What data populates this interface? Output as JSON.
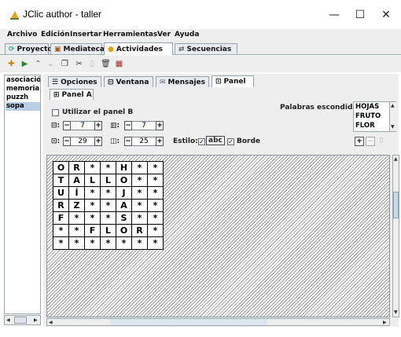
{
  "window": {
    "title": "JClic author - taller",
    "minimize": "—",
    "maximize": "☐",
    "close": "✕"
  },
  "menu": [
    "Archivo",
    "Edición",
    "Insertar",
    "Herramientas",
    "Ver",
    "Ayuda"
  ],
  "main_tabs": [
    {
      "label": "Proyecto",
      "icon": "project-icon"
    },
    {
      "label": "Mediateca",
      "icon": "media-icon"
    },
    {
      "label": "Actividades",
      "icon": "activities-icon"
    },
    {
      "label": "Secuencias",
      "icon": "sequences-icon"
    }
  ],
  "toolbar_icons": [
    "add-activity-icon",
    "play-icon",
    "up-icon",
    "down-icon",
    "copy-icon",
    "cut-icon",
    "paste-icon",
    "delete-icon",
    "grid-icon"
  ],
  "activity_list": [
    "asociació",
    "memoria",
    "puzzh",
    "sopa"
  ],
  "selected_activity": "sopa",
  "sub_tabs": [
    "Opciones",
    "Ventana",
    "Mensajes",
    "Panel"
  ],
  "panel_tab": "Panel A",
  "controls": {
    "use_panel_b": "Utilizar el panel B",
    "rows_value": "7",
    "cols_value": "7",
    "width_value": "29",
    "height_value": "25",
    "style_label": "Estilo:",
    "style_sample": "abc",
    "border_label": "Borde",
    "minus": "−",
    "plus": "+",
    "hidden_words_label": "Palabras escondidas:"
  },
  "hidden_words": [
    "HOJAS",
    "FRUTO",
    "FLOR"
  ],
  "grid": [
    [
      "O",
      "R",
      "*",
      "*",
      "H",
      "*",
      "*"
    ],
    [
      "T",
      "A",
      "L",
      "L",
      "O",
      "*",
      "*"
    ],
    [
      "U",
      "Í",
      "*",
      "*",
      "J",
      "*",
      "*"
    ],
    [
      "R",
      "Z",
      "*",
      "*",
      "A",
      "*",
      "*"
    ],
    [
      "F",
      "*",
      "*",
      "*",
      "S",
      "*",
      "*"
    ],
    [
      "*",
      "*",
      "F",
      "L",
      "O",
      "R",
      "*"
    ],
    [
      "*",
      "*",
      "*",
      "*",
      "*",
      "*",
      "*"
    ]
  ],
  "colors": {
    "accent": "#b9cfe6",
    "chrome": "#eeeeee"
  }
}
